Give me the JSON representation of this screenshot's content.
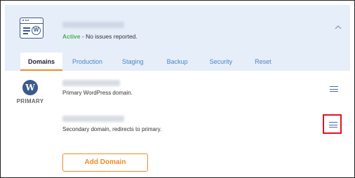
{
  "header": {
    "status_label": "Active",
    "status_message": " - No issues reported.",
    "tabs": [
      {
        "label": "Domains",
        "active": true
      },
      {
        "label": "Production"
      },
      {
        "label": "Staging"
      },
      {
        "label": "Backup"
      },
      {
        "label": "Security"
      },
      {
        "label": "Reset"
      }
    ]
  },
  "domains": {
    "primary_badge": "PRIMARY",
    "rows": [
      {
        "description": "Primary WordPress domain."
      },
      {
        "description": "Secondary domain, redirects to primary."
      }
    ]
  },
  "actions": {
    "add_domain_label": "Add Domain"
  },
  "colors": {
    "accent": "#f08a24",
    "active_green": "#4caf50",
    "header_bg": "#e6eef9",
    "highlight": "#e0141e"
  }
}
